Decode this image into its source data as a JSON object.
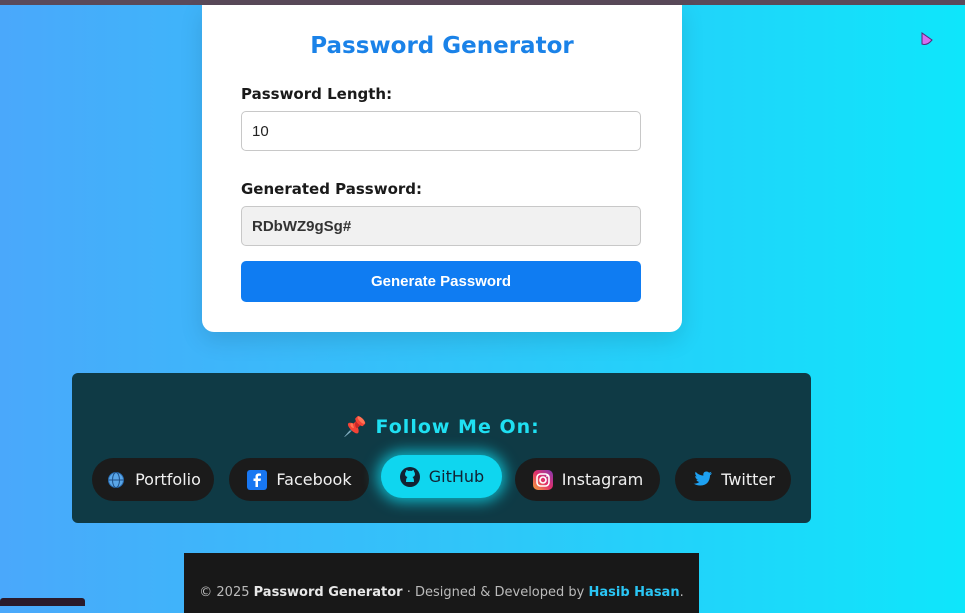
{
  "generator": {
    "title": "Password Generator",
    "length_label": "Password Length:",
    "length_value": "10",
    "output_label": "Generated Password:",
    "output_value": "RDbWZ9gSg#",
    "button_label": "Generate Password"
  },
  "follow": {
    "title": "📌 Follow Me On:",
    "links": [
      {
        "label": "Portfolio",
        "icon": "globe-icon"
      },
      {
        "label": "Facebook",
        "icon": "facebook-icon"
      },
      {
        "label": "GitHub",
        "icon": "github-icon"
      },
      {
        "label": "Instagram",
        "icon": "instagram-icon"
      },
      {
        "label": "Twitter",
        "icon": "twitter-icon"
      }
    ]
  },
  "footer": {
    "copyright": "© 2025",
    "app_name": "Password Generator",
    "designed_by": "· Designed & Developed by",
    "author": "Hasib Hasan",
    "end": "."
  },
  "colors": {
    "accent": "#1a82e8",
    "button": "#0f7cf2",
    "follow_title": "#1fe0f2"
  }
}
